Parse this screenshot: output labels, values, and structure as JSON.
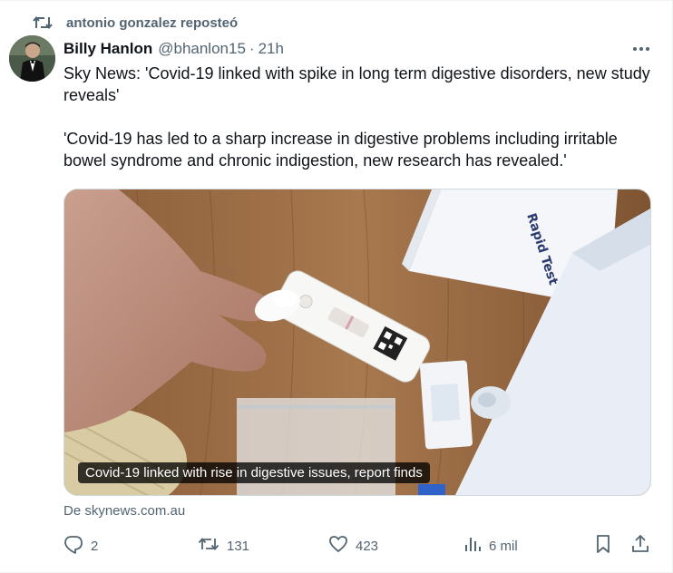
{
  "repost": {
    "text": "antonio gonzalez reposteó",
    "icon": "repost-icon"
  },
  "author": {
    "display_name": "Billy Hanlon",
    "handle": "@bhanlon15",
    "separator": "·",
    "time": "21h",
    "avatar_icon": "avatar"
  },
  "tweet": {
    "paragraph1": "Sky News: 'Covid-19 linked with spike in long term digestive disorders, new study reveals'",
    "paragraph2": "'Covid-19 has led to a sharp increase in digestive problems including irritable bowel syndrome and chronic indigestion, new research has revealed.'"
  },
  "media": {
    "caption": "Covid-19 linked with rise in digestive issues, report finds",
    "packet_text": "Rapid Test",
    "source": "De skynews.com.au"
  },
  "actions": {
    "replies": "2",
    "reposts": "131",
    "likes": "423",
    "views": "6 mil"
  },
  "colors": {
    "text_primary": "#0f1419",
    "text_secondary": "#536471",
    "border": "#cfd9de"
  }
}
